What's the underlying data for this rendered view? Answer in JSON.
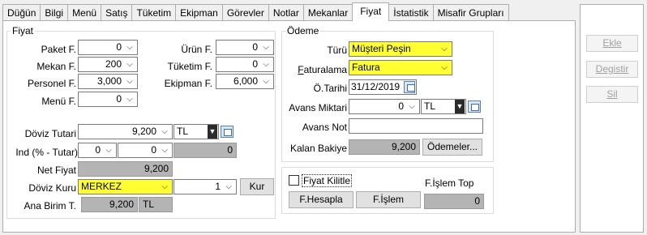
{
  "tabs": [
    "Düğün",
    "Bilgi",
    "Menü",
    "Satış",
    "Tüketim",
    "Ekipman",
    "Görevler",
    "Notlar",
    "Mekanlar",
    "Fiyat",
    "İstatistik",
    "Misafir Grupları"
  ],
  "active_tab": "Fiyat",
  "fiyat": {
    "legend": "Fiyat",
    "paket_label": "Paket F.",
    "paket_value": "0",
    "mekan_label": "Mekan F.",
    "mekan_value": "200",
    "personel_label": "Personel F.",
    "personel_value": "3,000",
    "menu_label": "Menü F.",
    "menu_value": "0",
    "urun_label": "Ürün F.",
    "urun_value": "0",
    "tuketim_label": "Tüketim F.",
    "tuketim_value": "0",
    "ekipman_label": "Ekipman F.",
    "ekipman_value": "6,000",
    "doviz_tutari_label": "Döviz Tutari",
    "doviz_tutari_value": "9,200",
    "doviz_currency": "TL",
    "ind_label": "Ind (% - Tutar)",
    "ind_pct": "0",
    "ind_amount": "0",
    "ind_result": "0",
    "net_fiyat_label": "Net Fiyat",
    "net_fiyat_value": "9,200",
    "doviz_kuru_label": "Döviz Kuru",
    "doviz_kuru_value": "MERKEZ",
    "kur_value": "1",
    "kur_button": "Kur",
    "ana_birim_label": "Ana Birim T.",
    "ana_birim_value": "9,200",
    "ana_birim_currency": "TL"
  },
  "odeme": {
    "legend": "Ödeme",
    "turu_label": "Türü",
    "turu_value": "Müşteri Peşin",
    "faturalama_label": "Faturalama",
    "faturalama_value": "Fatura",
    "o_tarihi_label": "Ö.Tarihi",
    "o_tarihi_value": "31/12/2019",
    "avans_miktari_label": "Avans Miktari",
    "avans_miktari_value": "0",
    "avans_currency": "TL",
    "avans_not_label": "Avans Not",
    "avans_not_value": "",
    "kalan_bakiye_label": "Kalan Bakiye",
    "kalan_bakiye_value": "9,200",
    "odemeler_button": "Ödemeler..."
  },
  "bottom": {
    "fiyat_kilitle_label": "Fiyat Kilitle",
    "f_hesapla_button": "F.Hesapla",
    "f_islem_button": "F.İşlem",
    "f_islem_top_label": "F.İşlem Top",
    "f_islem_top_value": "0"
  },
  "side_buttons": [
    "Ekle",
    "Degistir",
    "Sil"
  ],
  "colors": {
    "highlight": "#ffff33",
    "readonly": "#b4b4b4"
  }
}
